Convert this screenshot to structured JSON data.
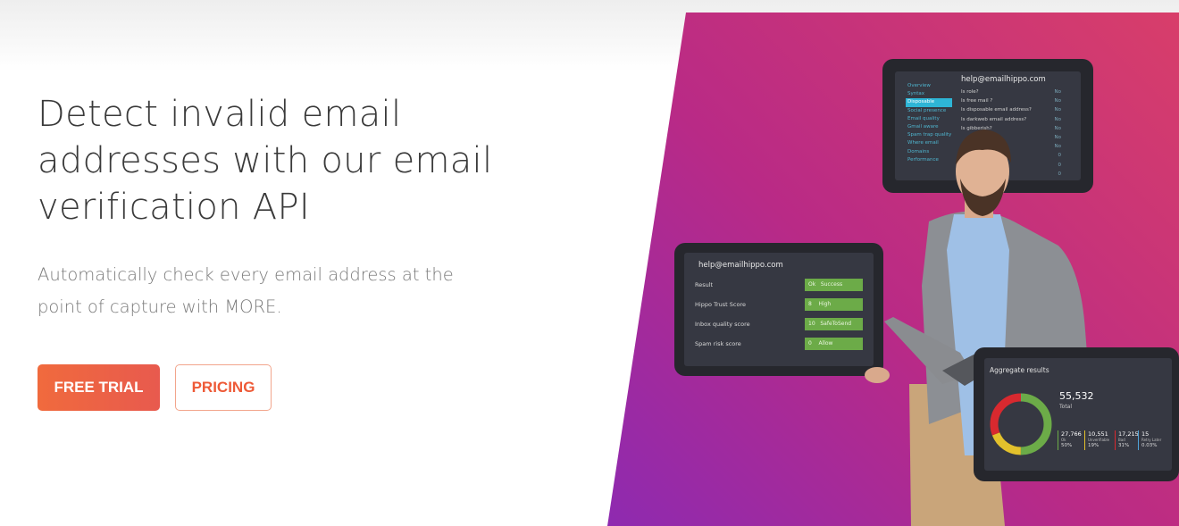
{
  "hero": {
    "headline": "Detect invalid email\naddresses with our email\nverification API",
    "subtext": "Automatically check every email address at the\npoint of capture with MORE.",
    "buttons": {
      "free_trial": "FREE TRIAL",
      "pricing": "PRICING"
    }
  },
  "colors": {
    "accent": "#ee5a37",
    "panel_purple": "#8e2ab0",
    "panel_pink": "#d83e6a",
    "ok_green": "#6cab48"
  },
  "top_tablet": {
    "email": "help@emailhippo.com",
    "sidebar": [
      "Overview",
      "Syntax",
      "Disposable",
      "Social presence",
      "Email quality",
      "Gmail aware",
      "Spam trap quality",
      "Where email",
      "Domains",
      "Performance"
    ],
    "active_index": 2,
    "rows": [
      {
        "label": "Is role?",
        "value": "No"
      },
      {
        "label": "Is free mail ?",
        "value": "No"
      },
      {
        "label": "Is disposable email address?",
        "value": "No"
      },
      {
        "label": "Is darkweb email address?",
        "value": "No"
      },
      {
        "label": "Is gibberish?",
        "value": "No"
      },
      {
        "label": "",
        "value": "No"
      },
      {
        "label": "",
        "value": "No"
      },
      {
        "label": "",
        "value": "0"
      },
      {
        "label": "",
        "value": "0"
      },
      {
        "label": "",
        "value": "0"
      }
    ]
  },
  "mid_tablet": {
    "email": "help@emailhippo.com",
    "rows": [
      {
        "label": "Result",
        "value": "Ok   Success"
      },
      {
        "label": "Hippo Trust Score",
        "value": "8    High"
      },
      {
        "label": "Inbox quality score",
        "value": "10   SafeToSend"
      },
      {
        "label": "Spam risk score",
        "value": "0    Allow"
      }
    ]
  },
  "bottom_tablet": {
    "title": "Aggregate results",
    "total": "55,532",
    "total_label": "Total",
    "stats": [
      {
        "n": "27,766",
        "k": "Ok",
        "p": "50%",
        "color": "#6cab48",
        "fraction": 0.5
      },
      {
        "n": "10,551",
        "k": "Unverifiable",
        "p": "19%",
        "color": "#e3c12c",
        "fraction": 0.19
      },
      {
        "n": "17,215",
        "k": "Bad",
        "p": "31%",
        "color": "#d8292f",
        "fraction": 0.31
      },
      {
        "n": "15",
        "k": "Retry Later",
        "p": "0.03%",
        "color": "#4fa3d9",
        "fraction": 0.0003
      }
    ]
  }
}
